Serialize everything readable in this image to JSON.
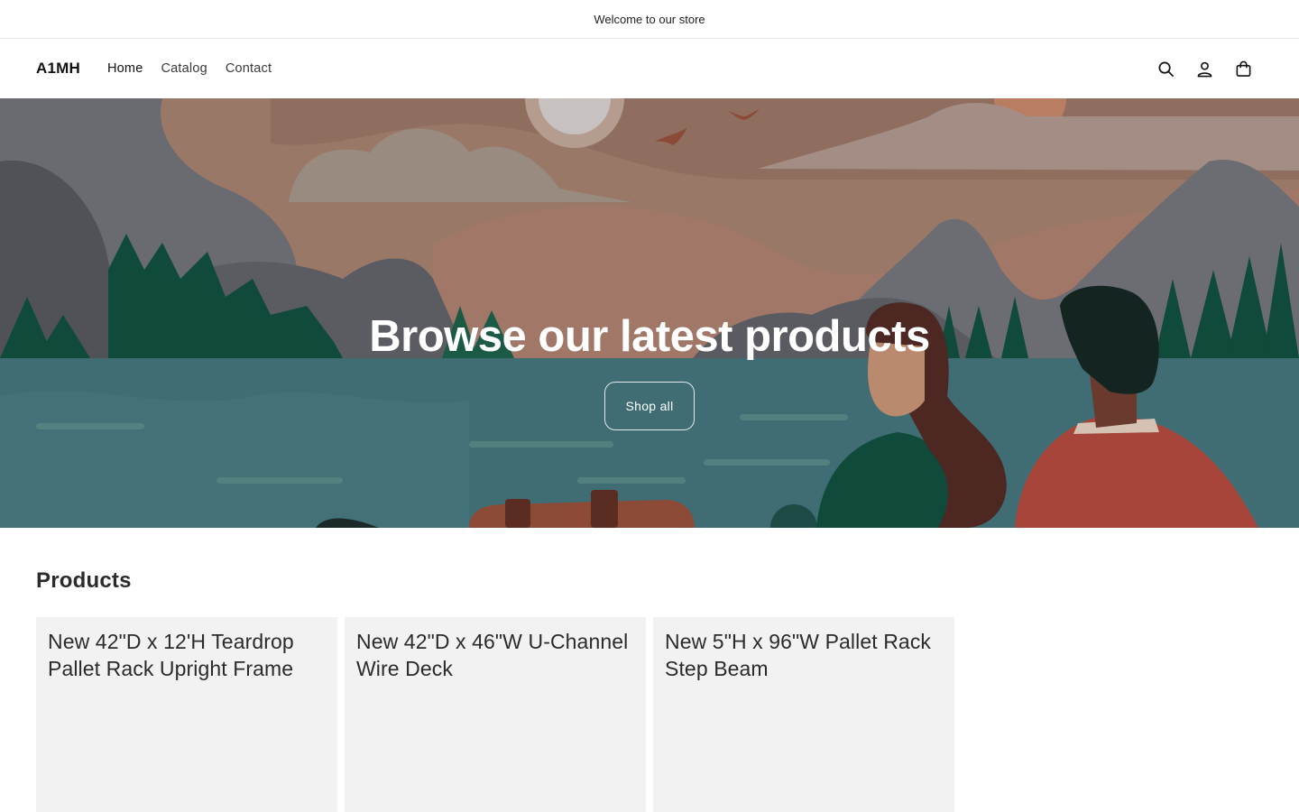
{
  "announcement": {
    "text": "Welcome to our store"
  },
  "header": {
    "logo": "A1MH",
    "nav": [
      {
        "label": "Home"
      },
      {
        "label": "Catalog"
      },
      {
        "label": "Contact"
      }
    ],
    "icons": [
      "search-icon",
      "account-icon",
      "cart-icon"
    ]
  },
  "hero": {
    "title": "Browse our latest products",
    "button_label": "Shop all",
    "colors": {
      "sky": "#9a7868",
      "lake": "#3f6d73",
      "mountain": "#5f6166",
      "trees": "#0f4a3a"
    }
  },
  "products": {
    "title": "Products",
    "items": [
      {
        "title": "New 42\"D x 12'H Teardrop Pallet Rack Upright Frame"
      },
      {
        "title": "New 42\"D x 46\"W U-Channel Wire Deck"
      },
      {
        "title": "New 5\"H x 96\"W Pallet Rack Step Beam"
      }
    ]
  }
}
